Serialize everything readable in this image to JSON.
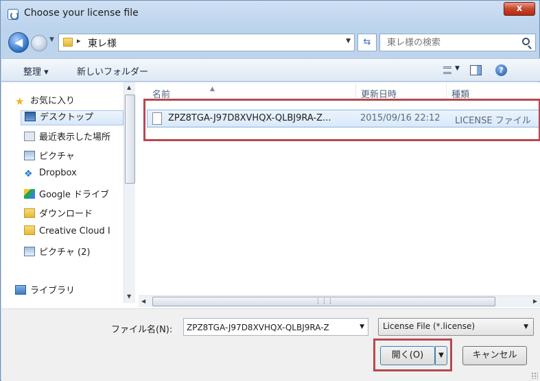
{
  "window": {
    "title": "Choose your license file",
    "close_label": "x"
  },
  "address_bar": {
    "path_separator": "▸",
    "current_folder": "東レ様",
    "search_placeholder": "東レ様の検索"
  },
  "toolbar": {
    "organize_label": "整理 ▾",
    "new_folder_label": "新しいフォルダー",
    "help_label": "?"
  },
  "nav_pane": {
    "items": [
      {
        "label": "お気に入り",
        "icon": "star-icon"
      },
      {
        "label": "デスクトップ",
        "icon": "desktop-icon",
        "selected": true
      },
      {
        "label": "最近表示した場所",
        "icon": "recent-places-icon"
      },
      {
        "label": "ピクチャ",
        "icon": "pictures-icon"
      },
      {
        "label": "Dropbox",
        "icon": "dropbox-icon"
      },
      {
        "label": "Google ドライブ",
        "icon": "google-drive-icon"
      },
      {
        "label": "ダウンロード",
        "icon": "downloads-icon"
      },
      {
        "label": "Creative Cloud I",
        "icon": "folder-icon"
      },
      {
        "label": "ピクチャ (2)",
        "icon": "pictures-icon"
      },
      {
        "label": "ライブラリ",
        "icon": "library-icon"
      }
    ]
  },
  "file_list": {
    "columns": [
      "名前",
      "更新日時",
      "種類"
    ],
    "rows": [
      {
        "name": "ZPZ8TGA-J97D8XVHQX-QLBJ9RA-Z...",
        "modified": "2015/09/16 22:12",
        "type": "LICENSE ファイル"
      }
    ]
  },
  "footer": {
    "filename_label": "ファイル名(N):",
    "filename_value": "ZPZ8TGA-J97D8XVHQX-QLBJ9RA-Z",
    "filetype_value": "License File (*.license)",
    "open_label": "開く(O)",
    "cancel_label": "キャンセル"
  },
  "colors": {
    "highlight_box": "#b8474e",
    "selection": "#d9e9fa"
  }
}
